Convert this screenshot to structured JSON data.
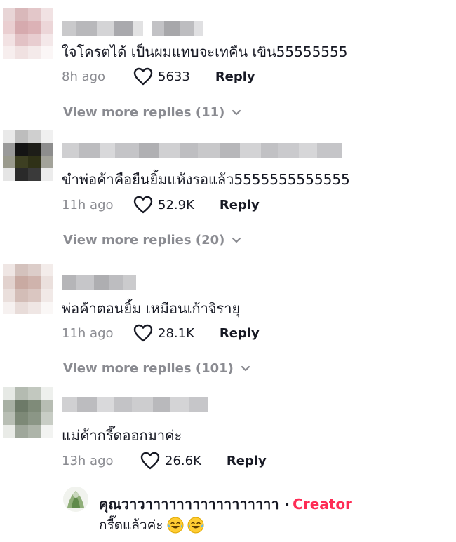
{
  "comments": [
    {
      "text": "ใจโครตได้ เป็นผมแทบจะเทคืน เขิน55555555",
      "time": "8h ago",
      "likes": "5633",
      "reply_label": "Reply",
      "view_more": "View more replies (11)"
    },
    {
      "text": "ขำพ่อค้าคือยืนยิ้มแห้งรอแล้ว5555555555555",
      "time": "11h ago",
      "likes": "52.9K",
      "reply_label": "Reply",
      "view_more": "View more replies (20)"
    },
    {
      "text": "พ่อค้าตอนยิ้ม เหมือนเก้าจิรายุ",
      "time": "11h ago",
      "likes": "28.1K",
      "reply_label": "Reply",
      "view_more": "View more replies (101)"
    },
    {
      "text": "แม่ค้ากรี๊ดออกมาค่ะ",
      "time": "13h ago",
      "likes": "26.6K",
      "reply_label": "Reply"
    }
  ],
  "creator_reply": {
    "username": "คุณวาวาาาาาาาาาาาาาาาาา",
    "separator": "·",
    "badge": "Creator",
    "text": "กรี๊ดแล้วค่ะ"
  },
  "colors": {
    "accent": "#fe2c55",
    "muted": "#8a8b91",
    "text": "#161823"
  },
  "icons": {
    "like": "heart-outline-icon",
    "expand": "chevron-down-icon",
    "emoji": "laughing-tears-emoji"
  }
}
